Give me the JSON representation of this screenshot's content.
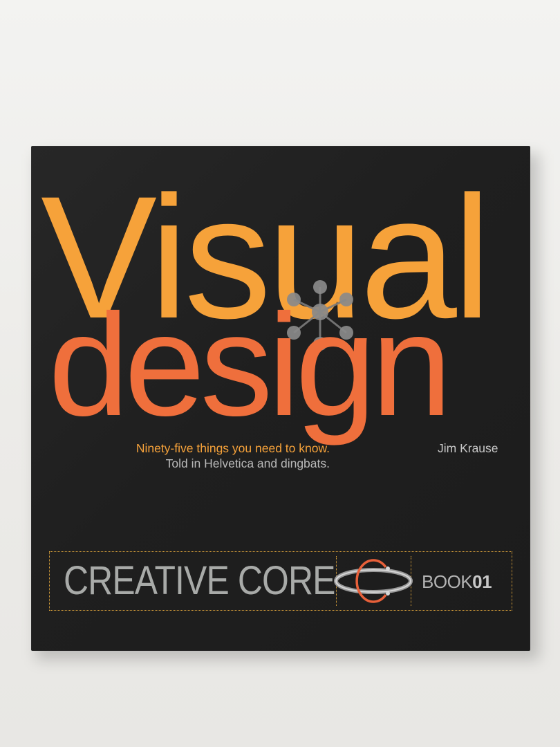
{
  "cover": {
    "title_line1": "Visual",
    "title_line2": "design",
    "subtitle_line1": "Ninety-five things you need to know.",
    "subtitle_line2": "Told in Helvetica and dingbats.",
    "author": "Jim Krause",
    "series_name": "CREATIVE CORE",
    "book_label": "BOOK",
    "book_number": "01"
  },
  "colors": {
    "cover_background": "#1f1f1f",
    "title_orange": "#f6a23a",
    "title_red_orange": "#ef6f3c",
    "series_gray": "#a8aaa8",
    "banner_border": "#d8a03a"
  },
  "icons": {
    "molecule": "molecule-dingbat-icon",
    "series_logo": "creative-core-orbit-logo"
  }
}
